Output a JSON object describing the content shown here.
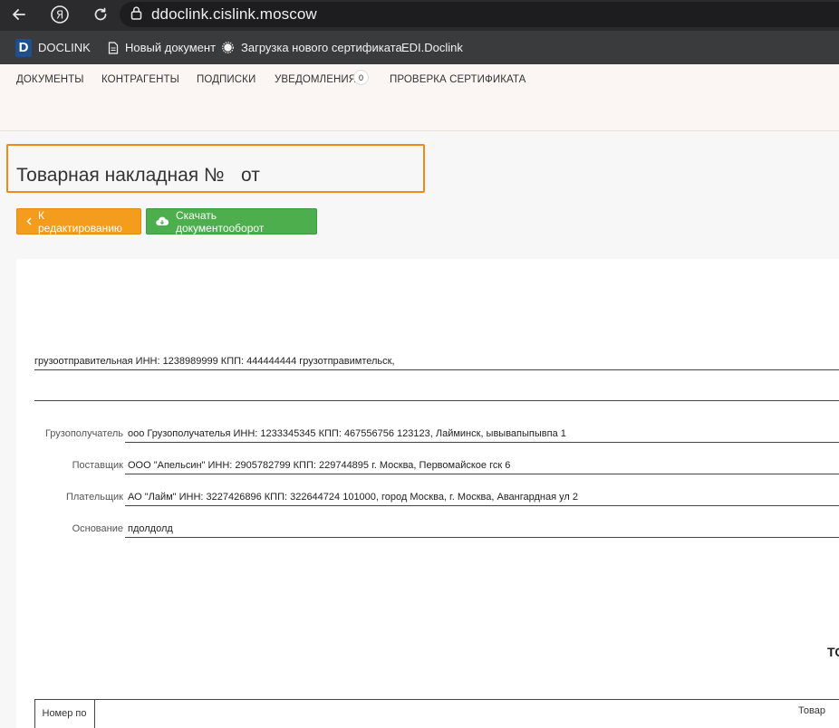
{
  "browser": {
    "url": "ddoclink.cislink.moscow",
    "yandex_glyph": "Я"
  },
  "appbar": {
    "logo_letter": "D",
    "logo_text": "DOCLINK",
    "new_doc": "Новый документ",
    "upload_cert": "Загрузка нового сертификата",
    "edi": "EDI.Doclink"
  },
  "nav": {
    "documents": "ДОКУМЕНТЫ",
    "contractors": "КОНТРАГЕНТЫ",
    "subscriptions": "ПОДПИСКИ",
    "notifications": "УВЕДОМЛЕНИЯ",
    "notifications_count": "0",
    "cert_check": "ПРОВЕРКА СЕРТИФИКАТА"
  },
  "page": {
    "title": "Товарная накладная №",
    "title_from": "от",
    "back_button": "К редактированию",
    "download_button": "Скачать документооборот"
  },
  "document": {
    "shipper_line": "грузоотправительная ИНН: 1238989999 КПП: 444444444 грузотправимтельск,",
    "fields": [
      {
        "label": "Грузополучатель",
        "value": "ооо Грузополучателья     ИНН: 1233345345 КПП: 467556756 123123, Лайминск, ывывапыпывпа 1"
      },
      {
        "label": "Поставщик",
        "value": "ООО \"Апельсин\" ИНН: 2905782799 КПП: 229744895 г. Москва, Первомайское гск 6"
      },
      {
        "label": "Плательщик",
        "value": "АО \"Лайм\"     ИНН: 3227426896 КПП: 322644724 101000, город Москва, г. Москва, Авангардная ул 2"
      },
      {
        "label": "Основание",
        "value": "пдолдолд"
      }
    ],
    "to_heading": "ТО",
    "table_head_num": "Номер по",
    "table_head_goods": "Товар"
  }
}
